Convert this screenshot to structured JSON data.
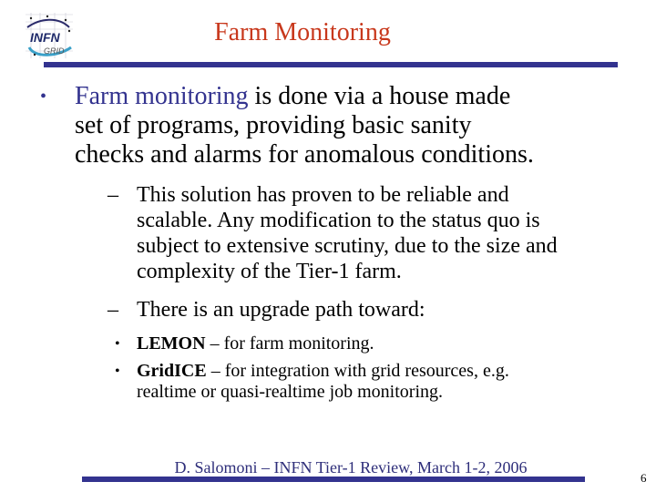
{
  "slide": {
    "title": "Farm Monitoring",
    "logo": {
      "name": "infn-grid-logo",
      "text_top": "INFN",
      "text_bottom": "GRID"
    },
    "colors": {
      "title": "#c8381c",
      "accent": "#33338f",
      "footer": "#2e2e7a"
    },
    "bullets": [
      {
        "marker": "•",
        "highlight": "Farm monitoring",
        "lines": [
          " is done via a house made",
          "set of programs, providing basic sanity",
          "checks and alarms for anomalous conditions."
        ]
      }
    ],
    "sub_bullets": [
      {
        "marker": "–",
        "lines": [
          "This solution has proven to be reliable and",
          "scalable. Any modification to the status quo is",
          "subject to extensive scrutiny, due to the size and",
          "complexity of the Tier-1 farm."
        ]
      },
      {
        "marker": "–",
        "lines": [
          "There is an upgrade path toward:"
        ]
      }
    ],
    "sub_sub_bullets": [
      {
        "marker": "•",
        "bold": "LEMON",
        "lines": [
          " – for farm monitoring."
        ]
      },
      {
        "marker": "•",
        "bold": "GridICE",
        "lines": [
          " – for integration with grid resources, e.g.",
          "realtime or quasi-realtime job monitoring."
        ]
      }
    ],
    "footer": "D. Salomoni – INFN Tier-1 Review, March 1-2, 2006",
    "page_number": "6"
  }
}
